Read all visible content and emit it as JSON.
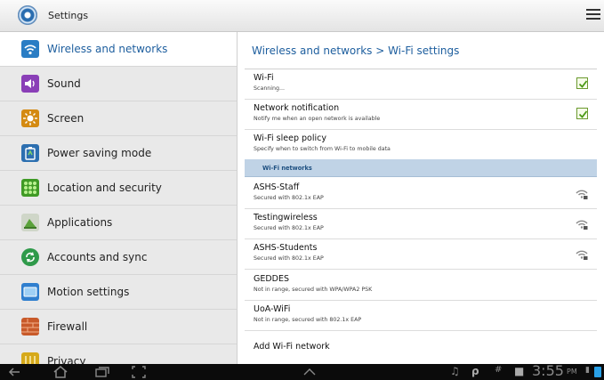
{
  "app": {
    "title": "Settings",
    "icon": "settings-icon"
  },
  "sidebar": {
    "items": [
      {
        "label": "Wireless and networks",
        "icon": "wifi-icon",
        "color": "#2a7dc4",
        "active": true
      },
      {
        "label": "Sound",
        "icon": "speaker-icon",
        "color": "#8a3fb7"
      },
      {
        "label": "Screen",
        "icon": "brightness-icon",
        "color": "#d48a12"
      },
      {
        "label": "Power saving mode",
        "icon": "battery-icon",
        "color": "#2c6fb0"
      },
      {
        "label": "Location and security",
        "icon": "grid-icon",
        "color": "#3f9a25"
      },
      {
        "label": "Applications",
        "icon": "applications-icon",
        "color": "#5aa23a"
      },
      {
        "label": "Accounts and sync",
        "icon": "sync-icon",
        "color": "#2f9a4a"
      },
      {
        "label": "Motion settings",
        "icon": "tablet-icon",
        "color": "#2f7fcf"
      },
      {
        "label": "Firewall",
        "icon": "firewall-icon",
        "color": "#c85a2a"
      },
      {
        "label": "Privacy",
        "icon": "privacy-icon",
        "color": "#d6a91a"
      }
    ]
  },
  "detail": {
    "breadcrumb": "Wireless and networks  >  Wi-Fi settings",
    "settings": [
      {
        "title": "Wi-Fi",
        "subtitle": "Scanning...",
        "checked": true
      },
      {
        "title": "Network notification",
        "subtitle": "Notify me when an open network is available",
        "checked": true
      },
      {
        "title": "Wi-Fi sleep policy",
        "subtitle": "Specify when to switch from Wi-Fi to mobile data"
      }
    ],
    "section_label": "Wi-Fi networks",
    "networks": [
      {
        "name": "ASHS-Staff",
        "status": "Secured with 802.1x EAP",
        "signal": "wifi-lock-icon"
      },
      {
        "name": "Testingwireless",
        "status": "Secured with 802.1x EAP",
        "signal": "wifi-lock-icon"
      },
      {
        "name": "ASHS-Students",
        "status": "Secured with 802.1x EAP",
        "signal": "wifi-lock-icon"
      },
      {
        "name": "GEDDES",
        "status": "Not in range, secured with WPA/WPA2 PSK"
      },
      {
        "name": "UoA-WiFi",
        "status": "Not in range, secured with 802.1x EAP"
      }
    ],
    "add_network": "Add Wi-Fi network"
  },
  "system_bar": {
    "time": "3:55",
    "ampm": "PM"
  }
}
